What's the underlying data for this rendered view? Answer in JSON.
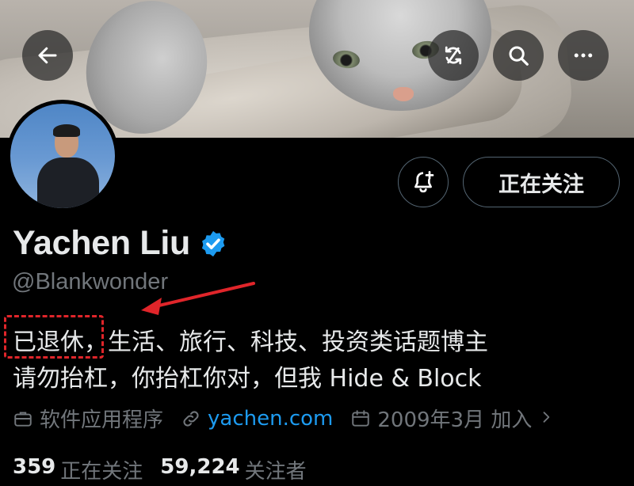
{
  "profile": {
    "name": "Yachen Liu",
    "handle": "@Blankwonder",
    "bio_highlight": "已退休，",
    "bio_line1_rest": "生活、旅行、科技、投资类话题博主",
    "bio_line2": "请勿抬杠，你抬杠你对，但我 Hide & Block",
    "category": "软件应用程序",
    "website": "yachen.com",
    "joined": "2009年3月 加入",
    "following_count": "359",
    "following_label": "正在关注",
    "followers_count": "59,224",
    "followers_label": "关注者"
  },
  "actions": {
    "follow_label": "正在关注"
  },
  "icons": {
    "back": "arrow-left-icon",
    "mute": "sync-off-icon",
    "search": "search-icon",
    "more": "more-icon",
    "notify": "bell-plus-icon",
    "verified": "verified-badge-icon",
    "category": "briefcase-icon",
    "link": "link-icon",
    "calendar": "calendar-icon"
  },
  "colors": {
    "accent": "#1d9bf0",
    "annotation": "#e0252a",
    "secondary_text": "#71767b"
  }
}
